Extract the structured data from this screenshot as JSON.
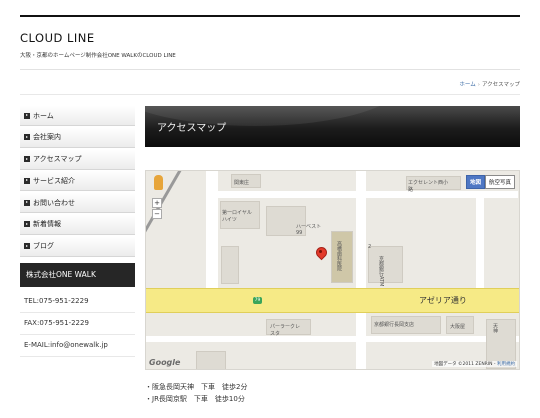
{
  "header": {
    "site_title": "CLOUD LINE",
    "tagline": "大阪・京都のホームページ制作会社ONE WALKのCLOUD LINE"
  },
  "breadcrumb": {
    "home": "ホーム",
    "separator": "›",
    "current": "アクセスマップ"
  },
  "sidebar": {
    "nav": [
      "ホーム",
      "会社案内",
      "アクセスマップ",
      "サービス紹介",
      "お問い合わせ",
      "新着情報",
      "ブログ"
    ],
    "company_name": "株式会社ONE WALK",
    "tel": "TEL:075-951-2229",
    "fax": "FAX:075-951-2229",
    "email": "E-MAIL:info@onewalk.jp"
  },
  "main": {
    "heading": "アクセスマップ",
    "map": {
      "map_button": "地図",
      "satellite_button": "航空写真",
      "zoom_in": "+",
      "zoom_out": "−",
      "avenue_name": "アゼリア通り",
      "route_number": "79",
      "google_logo": "Google",
      "copyright": "地図データ ©2011 ZENRIN -",
      "terms": "利用規約",
      "labels": {
        "l1": "関東庄",
        "l2": "第一ロイヤルハイツ",
        "l3": "ハーベスト99",
        "l4": "エクセレント西小路",
        "l5": "京都銀行ATM",
        "l6": "高橋歯科医院",
        "l7": "京都銀行長岡支店",
        "l8": "パーラークレスタ",
        "l9": "大阪屋",
        "l10": "天神",
        "l11": "2"
      }
    },
    "access": [
      "・阪急長岡天神　下車　徒歩2分",
      "・JR長岡京駅　下車　徒歩10分"
    ]
  },
  "colors": {
    "accent_dark": "#1c1c1c",
    "link": "#3a6aa5",
    "avenue": "#f6ea86"
  }
}
